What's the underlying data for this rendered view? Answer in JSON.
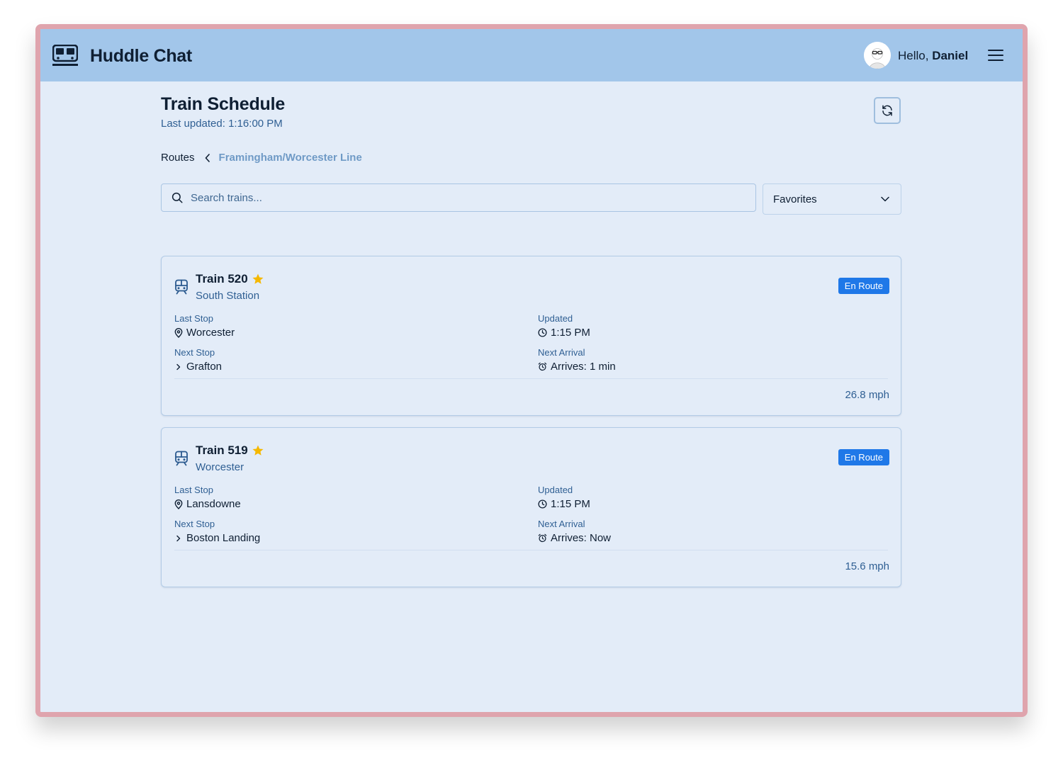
{
  "header": {
    "app_title": "Huddle Chat",
    "greeting_prefix": "Hello, ",
    "user_name": "Daniel"
  },
  "page": {
    "title": "Train Schedule",
    "last_updated": "Last updated: 1:16:00 PM"
  },
  "breadcrumb": {
    "root": "Routes",
    "current": "Framingham/Worcester Line"
  },
  "search": {
    "placeholder": "Search trains..."
  },
  "filter": {
    "selected": "Favorites"
  },
  "labels": {
    "last_stop": "Last Stop",
    "updated": "Updated",
    "next_stop": "Next Stop",
    "next_arrival": "Next Arrival"
  },
  "trains": [
    {
      "name": "Train 520",
      "destination": "South Station",
      "status": "En Route",
      "last_stop": "Worcester",
      "updated": "1:15 PM",
      "next_stop": "Grafton",
      "next_arrival": "Arrives: 1 min",
      "speed": "26.8 mph",
      "favorite": true
    },
    {
      "name": "Train 519",
      "destination": "Worcester",
      "status": "En Route",
      "last_stop": "Lansdowne",
      "updated": "1:15 PM",
      "next_stop": "Boston Landing",
      "next_arrival": "Arrives: Now",
      "speed": "15.6 mph",
      "favorite": true
    }
  ],
  "colors": {
    "header_bg": "#a2c6ea",
    "page_bg": "#e3ecf8",
    "accent_blue": "#1f78e8",
    "star": "#f5b800",
    "frame": "#dfa4ad"
  }
}
